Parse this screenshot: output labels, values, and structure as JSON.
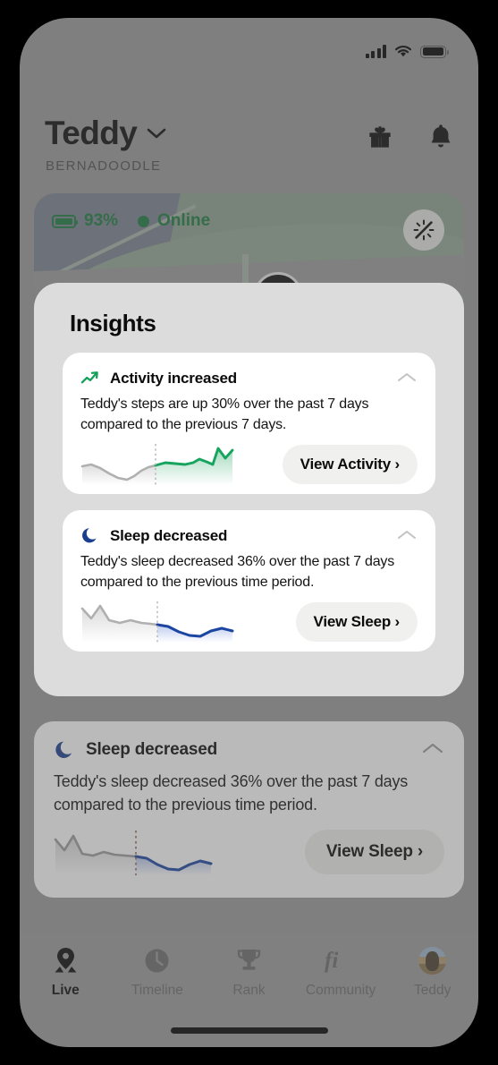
{
  "statusbar": {
    "cellular_icon": "cellular-bars-icon",
    "wifi_icon": "wifi-icon",
    "battery_icon": "battery-icon"
  },
  "header": {
    "pet_name": "Teddy",
    "pet_breed": "BERNADOODLE",
    "chevron_icon": "chevron-down-icon",
    "gift_icon": "gift-icon",
    "bell_icon": "bell-icon"
  },
  "map": {
    "battery_label": "93%",
    "status_label": "Online",
    "status_color": "#1a7a3e",
    "fab_icon": "brightness-slash-icon"
  },
  "sheet": {
    "title": "Insights",
    "cards": [
      {
        "icon": "trend-up-icon",
        "icon_color": "#13a05a",
        "title": "Activity increased",
        "body": "Teddy's steps are up 30% over the past 7 days compared to the previous 7 days.",
        "button": "View Activity ›",
        "collapse_icon": "chevron-up-icon"
      },
      {
        "icon": "moon-icon",
        "icon_color": "#1b3f8f",
        "title": "Sleep decreased",
        "body": "Teddy's sleep decreased 36% over the past 7 days compared to the previous time period.",
        "button": "View Sleep ›",
        "collapse_icon": "chevron-up-icon"
      }
    ]
  },
  "background_card": {
    "icon": "moon-icon",
    "icon_color": "#1b3f8f",
    "title": "Sleep decreased",
    "body": "Teddy's sleep decreased 36% over the past 7 days compared to the previous time period.",
    "button": "View Sleep ›",
    "collapse_icon": "chevron-up-icon"
  },
  "tabbar": {
    "items": [
      {
        "label": "Live",
        "icon": "location-pin-icon",
        "active": true
      },
      {
        "label": "Timeline",
        "icon": "clock-icon",
        "active": false
      },
      {
        "label": "Rank",
        "icon": "trophy-icon",
        "active": false
      },
      {
        "label": "Community",
        "icon": "fi-logo-icon",
        "active": false
      },
      {
        "label": "Teddy",
        "icon": "avatar-icon",
        "active": false
      }
    ]
  },
  "chart_data": [
    {
      "type": "line",
      "title": "Activity sparkline",
      "series": [
        {
          "name": "previous 7 days",
          "color": "#b0b0b0",
          "values": [
            52,
            50,
            46,
            40,
            34,
            30,
            34,
            42,
            50,
            54
          ]
        },
        {
          "name": "past 7 days",
          "color": "#13a05a",
          "values": [
            54,
            58,
            57,
            56,
            58,
            62,
            60,
            56,
            78,
            64,
            76
          ]
        }
      ],
      "divider": "dotted vertical at boundary between periods",
      "ylabel": "",
      "xlabel": "",
      "grid": false,
      "legend": false
    },
    {
      "type": "line",
      "title": "Sleep sparkline",
      "series": [
        {
          "name": "previous time period",
          "color": "#b0b0b0",
          "values": [
            72,
            60,
            78,
            56,
            52,
            58,
            54,
            52,
            50,
            50
          ]
        },
        {
          "name": "past 7 days",
          "color": "#1b45a0",
          "values": [
            50,
            48,
            40,
            30,
            26,
            28,
            38,
            44,
            40
          ]
        }
      ],
      "divider": "dotted vertical at boundary between periods",
      "ylabel": "",
      "xlabel": "",
      "grid": false,
      "legend": false
    },
    {
      "type": "line",
      "title": "Sleep sparkline (background card)",
      "series": [
        {
          "name": "previous time period",
          "color": "#9b9b9b",
          "values": [
            72,
            60,
            78,
            56,
            52,
            58,
            54,
            52,
            50,
            50
          ]
        },
        {
          "name": "past 7 days",
          "color": "#1b45a0",
          "values": [
            50,
            48,
            40,
            30,
            26,
            28,
            38,
            44,
            40
          ]
        }
      ],
      "divider": "dotted vertical at boundary between periods",
      "ylabel": "",
      "xlabel": "",
      "grid": false,
      "legend": false
    }
  ]
}
